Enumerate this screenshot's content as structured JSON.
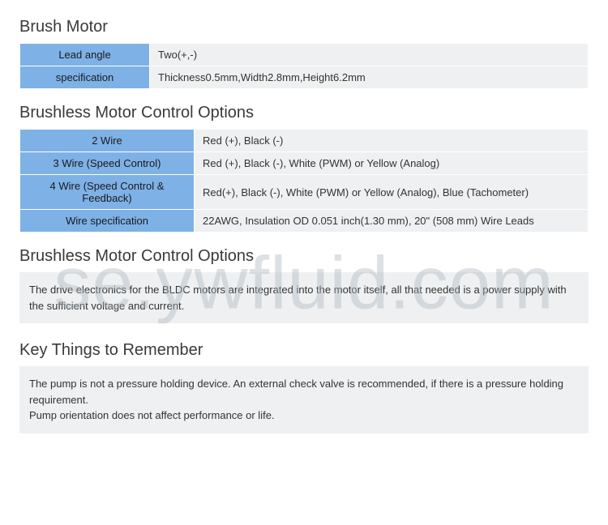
{
  "watermark": "se.ywfluid.com",
  "section1": {
    "title": "Brush Motor",
    "rows": [
      {
        "label": "Lead angle",
        "value": "Two(+,-)"
      },
      {
        "label": "specification",
        "value": "Thickness0.5mm,Width2.8mm,Height6.2mm"
      }
    ]
  },
  "section2": {
    "title": "Brushless Motor Control Options",
    "rows": [
      {
        "label": "2 Wire",
        "value": "Red (+), Black (-)"
      },
      {
        "label": "3 Wire (Speed Control)",
        "value": "Red (+), Black (-), White (PWM) or Yellow (Analog)"
      },
      {
        "label": "4 Wire (Speed Control & Feedback)",
        "value": "Red(+), Black (-), White (PWM) or Yellow (Analog), Blue (Tachometer)"
      },
      {
        "label": "Wire specification",
        "value": "22AWG, Insulation OD 0.051 inch(1.30 mm), 20\" (508 mm) Wire Leads"
      }
    ]
  },
  "section3": {
    "title": "Brushless Motor Control Options",
    "body": "The drive electronics for the BLDC motors are integrated into the motor itself, all that needed is a power supply with the sufficient voltage and current."
  },
  "section4": {
    "title": "Key Things to Remember",
    "line1": "The pump is not a pressure holding device. An external check valve is recommended, if there is a pressure holding requirement.",
    "line2": "Pump orientation does not affect performance or life."
  }
}
